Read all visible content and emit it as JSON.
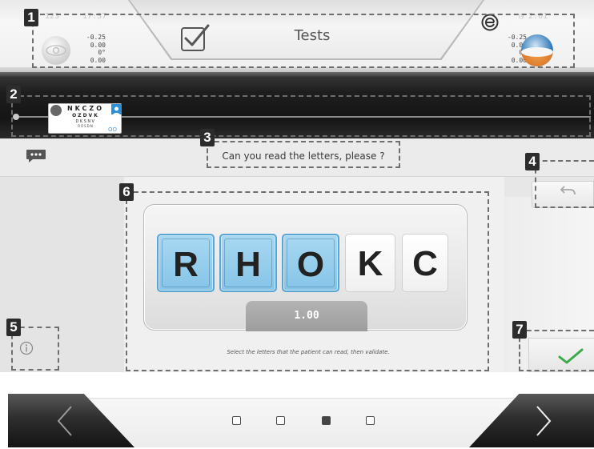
{
  "header": {
    "title": "Tests",
    "faded_left_a": "123",
    "faded_left_b": "17:37",
    "faded_right": "◷ 2:01",
    "left_eye_values": [
      "-0.25",
      "0.00",
      "0°",
      "0.00"
    ],
    "right_eye_values": [
      "-0.25",
      "0.00",
      "0°",
      "0.00"
    ]
  },
  "strip": {
    "chart_rows": [
      "NKCZO",
      "OZDVK",
      "DKSNV",
      "ROSDN"
    ],
    "chart_tiny": "OO"
  },
  "question": {
    "text": "Can you read the letters, please ?"
  },
  "test": {
    "letters": [
      {
        "char": "R",
        "selected": true
      },
      {
        "char": "H",
        "selected": true
      },
      {
        "char": "O",
        "selected": true
      },
      {
        "char": "K",
        "selected": false
      },
      {
        "char": "C",
        "selected": false
      }
    ],
    "acuity": "1.00",
    "instruction": "Select the letters that the patient can read, then validate."
  },
  "annotations": [
    "1",
    "2",
    "3",
    "4",
    "5",
    "6",
    "7"
  ],
  "pagination": {
    "count": 4,
    "active_index": 2
  },
  "colors": {
    "selected_letter": "#8fcaea",
    "selected_border": "#5aa6d2",
    "validate_check": "#3caa4c",
    "right_eye_blue": "#2f78b9",
    "right_eye_orange": "#e0802e"
  }
}
